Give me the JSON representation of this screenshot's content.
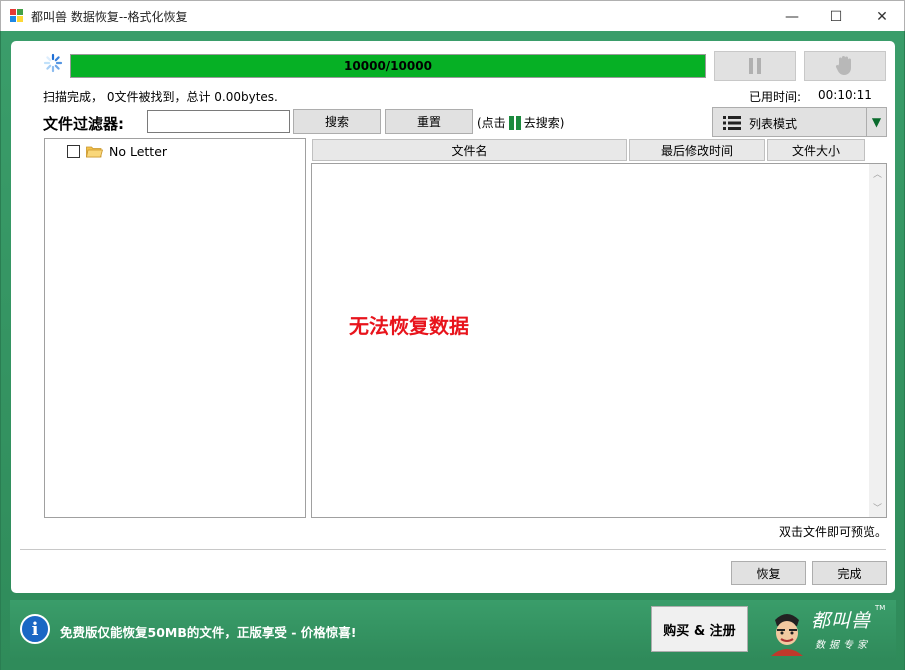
{
  "window": {
    "title": "都叫兽 数据恢复--格式化恢复",
    "minimize": "—",
    "maximize": "☐",
    "close": "✕"
  },
  "scan": {
    "progress_text": "10000/10000",
    "progress_fraction": 1.0,
    "status": "扫描完成， 0文件被找到，总计 0.00bytes.",
    "time_label": "已用时间:",
    "time_value": "00:10:11"
  },
  "filter": {
    "label": "文件过滤器:",
    "input_value": "",
    "search_button": "搜索",
    "reset_button": "重置",
    "hint_prefix": "(点击",
    "hint_suffix": "去搜索)"
  },
  "view_mode": {
    "selected": "列表模式"
  },
  "tree": {
    "items": [
      {
        "label": "No Letter",
        "checked": false
      }
    ]
  },
  "table": {
    "columns": [
      "文件名",
      "最后修改时间",
      "文件大小"
    ],
    "empty_message": "无法恢复数据"
  },
  "preview_hint": "双击文件即可预览。",
  "actions": {
    "recover": "恢复",
    "finish": "完成"
  },
  "banner": {
    "message": "免费版仅能恢复50MB的文件，正版享受 - 价格惊喜!",
    "buy_button": "购买 & 注册",
    "logo_name": "都叫兽",
    "logo_subtitle": "数据专家",
    "logo_tm": "TM"
  },
  "colors": {
    "progress_green": "#06b025",
    "frame_green": "#3a9d6a",
    "error_red": "#e8141c",
    "info_blue": "#1a67c4"
  }
}
